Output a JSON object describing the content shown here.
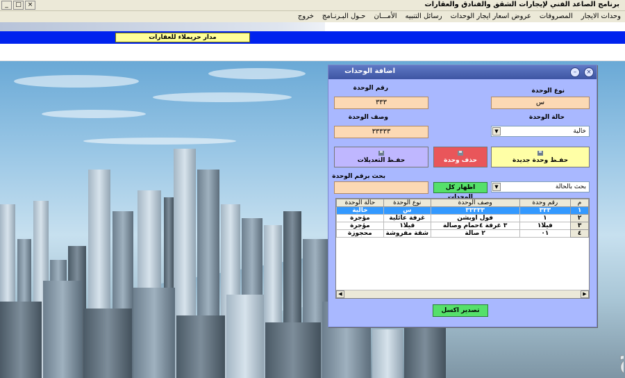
{
  "window": {
    "title": "برنامج الصاعد الفني لإيجارات الشقق والفنادق والعقارات",
    "minimize_glyph": "_",
    "maximize_glyph": "□",
    "close_glyph": "×"
  },
  "menu": [
    "وحدات الايجار",
    "المصروفات",
    "عروض اسعار ايجار الوحدات",
    "رسائل التنبيه",
    "الأمـــان",
    "حـول البـرنـامج",
    "خروج"
  ],
  "banner": {
    "label": "مدار حريملاء للعقارات"
  },
  "dialog": {
    "title": "اضافة الوحدات",
    "close_glyph": "×",
    "minimize_glyph": "–",
    "unit_type_label": "نوع الوحدة",
    "unit_type_value": "س",
    "unit_number_label": "رقم الوحدة",
    "unit_number_value": "٣٣٣",
    "unit_status_label": "حالة الوحدة",
    "unit_status_value": "خالية",
    "unit_desc_label": "وصف الوحدة",
    "unit_desc_value": "٣٣٣٣٣",
    "btn_save_new": "حفـظ وحدة جديدة",
    "btn_delete": "حذف وحدة",
    "btn_save_edits": "حفـظ التعديلات",
    "search_status_value": "بحث بالحالة",
    "btn_show_all": "اظهار كل الوحدات",
    "search_number_label": "بحث برقم الوحدة",
    "search_number_value": "",
    "btn_export": "تصدير اكسل",
    "grid": {
      "headers": [
        "م",
        "رقم وحدة",
        "وصف الوحدة",
        "نوع الوحدة",
        "حالة الوحدة"
      ],
      "rows": [
        {
          "n": "١",
          "number": "٣٣٣",
          "desc": "٣٣٣٣٣",
          "type": "س",
          "status": "خالية"
        },
        {
          "n": "٢",
          "number": "١",
          "desc": "فول اوبشن",
          "type": "غرفة عائلية",
          "status": "مؤجرة"
        },
        {
          "n": "٣",
          "number": "فيلا١",
          "desc": "٣ غرفة ٤حمام وصالة",
          "type": "فيلا١",
          "status": "مؤجرة"
        },
        {
          "n": "٤",
          "number": "٠١",
          "desc": "٢ صالة",
          "type": "شقة مفروشة",
          "status": "محجوزة"
        }
      ]
    }
  },
  "watermark": {
    "text": "حراج"
  }
}
